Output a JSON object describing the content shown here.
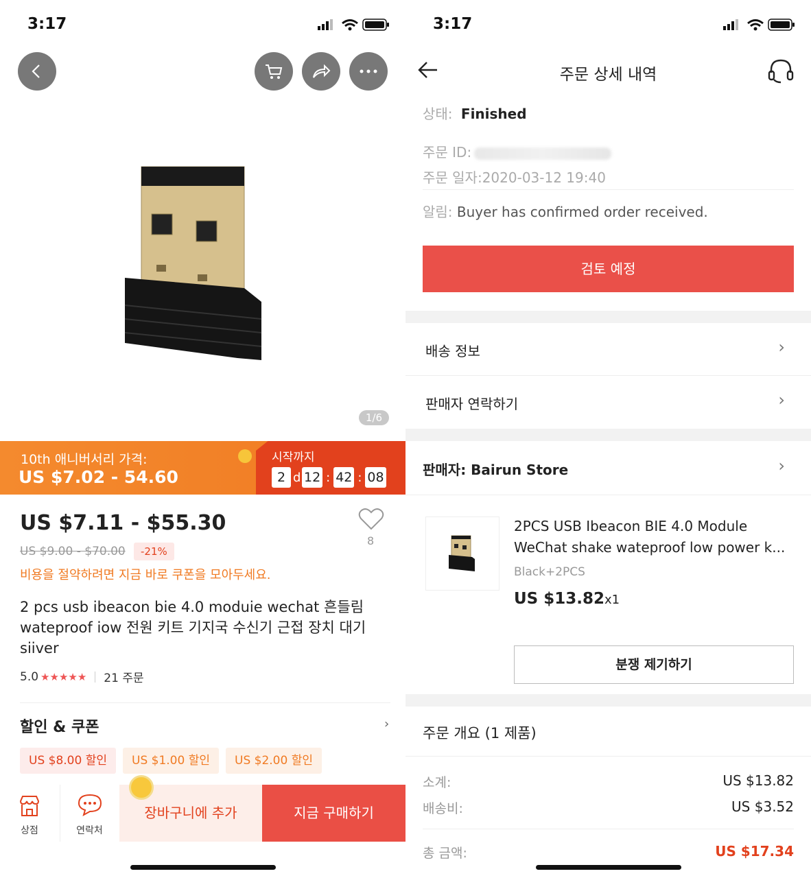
{
  "left": {
    "status": {
      "time": "3:17"
    },
    "image_counter": "1/6",
    "promo": {
      "label": "10th 애니버서리 가격:",
      "price": "US $7.02 - 54.60",
      "countdown_title": "시작까지",
      "days": "2",
      "day_unit": "d",
      "hours": "12",
      "minutes": "42",
      "seconds": "08"
    },
    "price": "US $7.11 - $55.30",
    "old_price": "US $9.00 - $70.00",
    "discount": "-21%",
    "wishlist_count": "8",
    "coupon_tip": "비용을 절약하려면 지금 바로 쿠폰을 모아두세요.",
    "title": "2 pcs usb ibeacon bie 4.0 moduie wechat 흔들림 wateproof iow 전원 키트 기지국 수신기 근접 장치 대기 siiver",
    "rating": "5.0",
    "orders": "21 주문",
    "coupons_section_title": "할인 & 쿠폰",
    "coupons": [
      "US $8.00 할인",
      "US $1.00 할인",
      "US $2.00 할인"
    ],
    "bottom": {
      "store_label": "상점",
      "contact_label": "연락처",
      "add_to_cart": "장바구니에 추가",
      "buy_now": "지금 구매하기"
    }
  },
  "right": {
    "status": {
      "time": "3:17"
    },
    "nav_title": "주문 상세 내역",
    "status_label": "상태:",
    "status_value": "Finished",
    "order_id_label": "주문 ID:",
    "order_date_label": "주문 일자:",
    "order_date_value": "2020-03-12 19:40",
    "notice_label": "알림:",
    "notice_value": "Buyer has confirmed order received.",
    "review_button": "검토 예정",
    "shipping_info": "배송 정보",
    "contact_seller": "판매자 연락하기",
    "seller_label": "판매자: Bairun Store",
    "product": {
      "name": "2PCS USB Ibeacon BIE 4.0 Module WeChat shake wateproof low power k...",
      "variant": "Black+2PCS",
      "price": "US $13.82",
      "qty": "x1"
    },
    "dispute_button": "분쟁 제기하기",
    "summary": {
      "title": "주문 개요 (1 제품)",
      "subtotal_label": "소계:",
      "subtotal_value": "US $13.82",
      "shipping_label": "배송비:",
      "shipping_value": "US $3.52",
      "total_label": "총 금액:",
      "total_value": "US $17.34"
    }
  },
  "colors": {
    "accent_red": "#ea4f45",
    "promo_orange": "#f07a22",
    "countdown_red": "#e2411d"
  }
}
